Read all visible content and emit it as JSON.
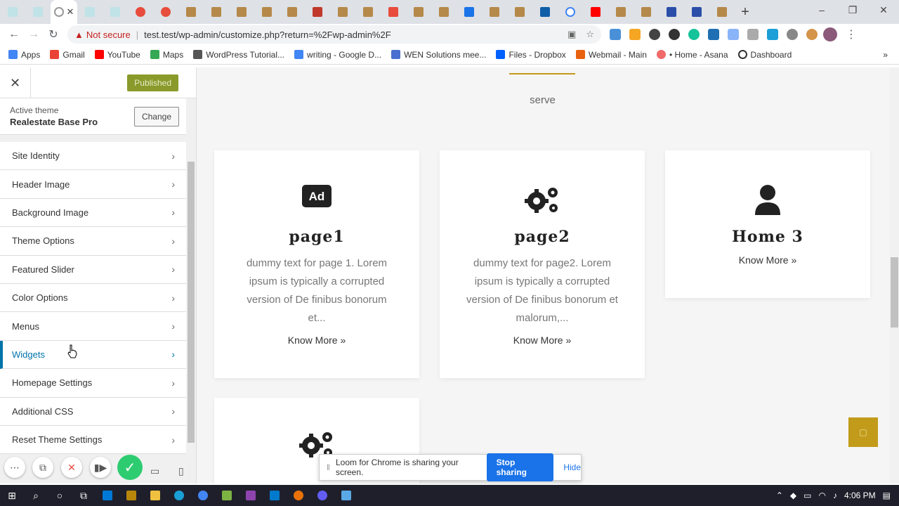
{
  "browser": {
    "address": {
      "warning": "Not secure",
      "url": "test.test/wp-admin/customize.php?return=%2Fwp-admin%2F"
    },
    "bookmarks": [
      {
        "label": "Apps",
        "color": "#4285f4"
      },
      {
        "label": "Gmail",
        "color": "#ea4335"
      },
      {
        "label": "YouTube",
        "color": "#ff0000"
      },
      {
        "label": "Maps",
        "color": "#34a853"
      },
      {
        "label": "WordPress Tutorial...",
        "color": "#555555"
      },
      {
        "label": "writing - Google D...",
        "color": "#4285f4"
      },
      {
        "label": "WEN Solutions mee...",
        "color": "#4a6fd1"
      },
      {
        "label": "Files - Dropbox",
        "color": "#0061ff"
      },
      {
        "label": "Webmail - Main",
        "color": "#e8610f"
      },
      {
        "label": "• Home - Asana",
        "color": "#f06a6a"
      },
      {
        "label": "Dashboard",
        "color": "#333333"
      }
    ]
  },
  "customizer": {
    "published_label": "Published",
    "active_theme_label": "Active theme",
    "theme_name": "Realestate Base Pro",
    "change_label": "Change",
    "menu": [
      "Site Identity",
      "Header Image",
      "Background Image",
      "Theme Options",
      "Featured Slider",
      "Color Options",
      "Menus",
      "Widgets",
      "Homepage Settings",
      "Additional CSS",
      "Reset Theme Settings"
    ],
    "active_item": "Widgets"
  },
  "preview": {
    "section_subtitle": "serve",
    "cards": [
      {
        "icon": "ad-icon",
        "title": "page1",
        "text": "dummy text for page 1. Lorem ipsum is typically a corrupted version of De finibus bonorum et...",
        "more": "Know More »"
      },
      {
        "icon": "gears-icon",
        "title": "page2",
        "text": "dummy text for page2. Lorem ipsum is typically a corrupted version of De finibus bonorum et malorum,...",
        "more": "Know More »"
      },
      {
        "icon": "user-icon",
        "title": "Home 3",
        "text": "",
        "more": "Know More »"
      }
    ]
  },
  "loom": {
    "message": "Loom for Chrome is sharing your screen.",
    "stop_label": "Stop sharing",
    "hide_label": "Hide"
  },
  "taskbar": {
    "time": "4:06 PM"
  },
  "colors": {
    "accent_gold": "#c29b1a",
    "wp_blue": "#0073aa",
    "published_green": "#8a9a2b"
  }
}
